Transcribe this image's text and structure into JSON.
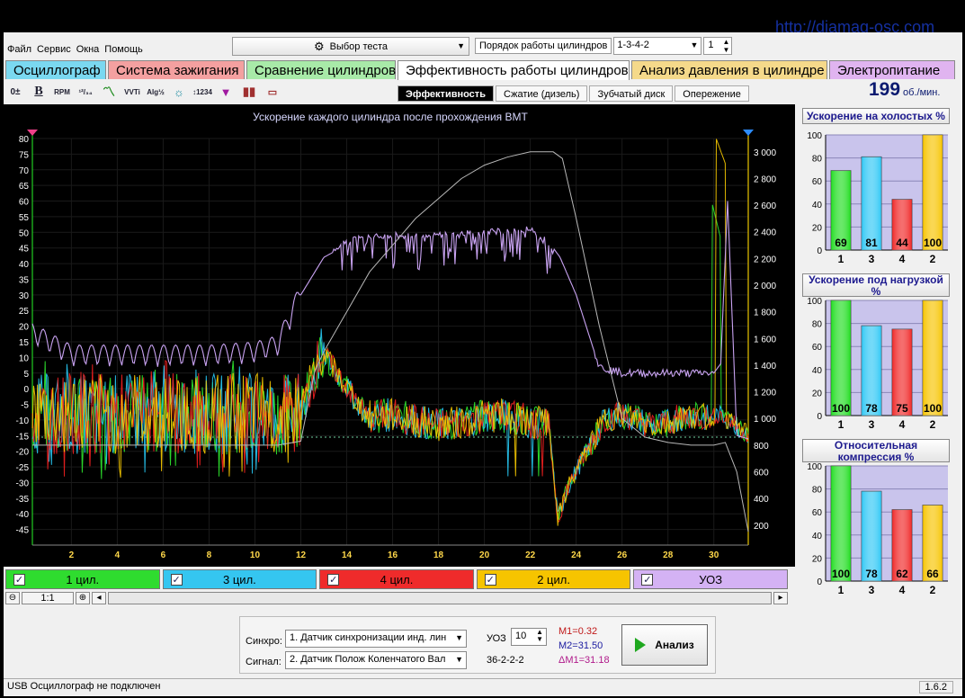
{
  "watermark": "http://diamag-osc.com",
  "menu": [
    "Файл",
    "Сервис",
    "Окна",
    "Помощь"
  ],
  "test_select": {
    "label": "Выбор теста"
  },
  "cylinder_order": {
    "label": "Порядок работы цилиндров",
    "value": "1-3-4-2",
    "spin_value": "1"
  },
  "tabs": [
    {
      "label": "Осциллограф",
      "color": "#7ad8f0"
    },
    {
      "label": "Система зажигания",
      "color": "#f4a0a0"
    },
    {
      "label": "Сравнение цилиндров",
      "color": "#a8eaa8"
    },
    {
      "label": "Эффективность работы цилиндров",
      "color": "#ffffff",
      "active": true
    },
    {
      "label": "Анализ давления в цилиндре",
      "color": "#f5d98a"
    },
    {
      "label": "Электропитание",
      "color": "#e0b4f0"
    }
  ],
  "toolbar_icons": [
    "zoom-spin-icon",
    "bold-icon",
    "rpm-icon",
    "ratio-icon",
    "line-icon",
    "vvti-icon",
    "alg-icon",
    "sensor-icon",
    "measure-icon",
    "filter-icon",
    "cylinders-icon",
    "print-icon"
  ],
  "subtabs": [
    "Эффективность",
    "Сжатие (дизель)",
    "Зубчатый диск",
    "Опережение"
  ],
  "rpm": {
    "value": "199",
    "unit": "об./мин."
  },
  "chart_data": {
    "type": "line",
    "title": "Ускорение каждого цилиндра после прохождения ВМТ",
    "x_ticks": [
      2,
      4,
      6,
      8,
      10,
      12,
      14,
      16,
      18,
      20,
      22,
      24,
      26,
      28,
      30
    ],
    "xlim": [
      0.3,
      31.5
    ],
    "left_ticks": [
      80,
      75,
      70,
      65,
      60,
      55,
      50,
      45,
      40,
      35,
      30,
      25,
      20,
      15,
      10,
      5,
      0,
      -5,
      -10,
      -15,
      -20,
      -25,
      -30,
      -35,
      -40,
      -45
    ],
    "left_ylim": [
      -50,
      80
    ],
    "right_ticks": [
      "3 000",
      "2 800",
      "2 600",
      "2 400",
      "2 200",
      "2 000",
      "1 800",
      "1 600",
      "1 400",
      "1 200",
      "1 000",
      "800",
      "600",
      "400",
      "200"
    ],
    "right_ylim": [
      50,
      3100
    ],
    "rpm_curve": {
      "x": [
        0.3,
        10,
        11,
        12,
        12.6,
        13,
        14,
        15,
        16,
        17,
        18,
        19,
        20,
        21,
        22,
        22.5,
        23,
        23.4,
        24,
        25,
        26,
        27,
        28,
        29,
        30,
        30.5,
        31,
        31.5
      ],
      "y": [
        800,
        800,
        800,
        830,
        1350,
        1500,
        1800,
        2100,
        2300,
        2500,
        2650,
        2800,
        2900,
        2960,
        3000,
        3000,
        3000,
        2950,
        2500,
        1700,
        1000,
        860,
        820,
        800,
        800,
        820,
        600,
        150
      ]
    },
    "uoz_curve": {
      "x": [
        0.3,
        2,
        5,
        8,
        10,
        11,
        12,
        13,
        14,
        15,
        16,
        18,
        20,
        22,
        23,
        23.3,
        24,
        25,
        26,
        27,
        28,
        29,
        30,
        30.3,
        30.6,
        31,
        31.5
      ],
      "y": [
        17,
        10,
        10,
        10,
        11,
        13,
        30,
        42,
        46,
        48,
        48,
        48,
        49,
        50,
        45,
        42,
        30,
        7,
        5,
        5,
        5,
        5,
        5,
        8,
        60,
        -15,
        -16
      ]
    },
    "series": [
      {
        "name": "1 цил.",
        "color": "#2ee62e"
      },
      {
        "name": "3 цил.",
        "color": "#27c7f2"
      },
      {
        "name": "4 цил.",
        "color": "#f02020"
      },
      {
        "name": "2 цил.",
        "color": "#f5c800"
      }
    ],
    "uoz_color": "#c9a3f2",
    "rpm_color": "#b8b8b8",
    "marker_left_color": "#f0408a",
    "marker_right_color": "#2d8cff"
  },
  "legend": [
    {
      "label": "1 цил.",
      "color": "#2fdc2f"
    },
    {
      "label": "3 цил.",
      "color": "#35c6f0"
    },
    {
      "label": "4 цил.",
      "color": "#ef2b2b"
    },
    {
      "label": "2 цил.",
      "color": "#f6c400"
    },
    {
      "label": "УОЗ",
      "color": "#d4b2f4"
    }
  ],
  "zoom": {
    "label": "1:1"
  },
  "bar_charts": [
    {
      "title": "Ускорение на холостых %",
      "categories": [
        "1",
        "3",
        "4",
        "2"
      ],
      "values": [
        69,
        81,
        44,
        100
      ],
      "ylim": [
        0,
        100
      ],
      "ticks": [
        100,
        80,
        60,
        40,
        20,
        0
      ]
    },
    {
      "title": "Ускорение под нагрузкой %",
      "categories": [
        "1",
        "3",
        "4",
        "2"
      ],
      "values": [
        100,
        78,
        75,
        100
      ],
      "ylim": [
        0,
        100
      ],
      "ticks": [
        100,
        80,
        60,
        40,
        20,
        0
      ]
    },
    {
      "title": "Относительная компрессия %",
      "categories": [
        "1",
        "3",
        "4",
        "2"
      ],
      "values": [
        100,
        78,
        62,
        66
      ],
      "ylim": [
        0,
        100
      ],
      "ticks": [
        100,
        80,
        60,
        40,
        20,
        0
      ]
    }
  ],
  "bar_colors": [
    "#22dd22",
    "#30c8f5",
    "#f02828",
    "#f7c400"
  ],
  "controls": {
    "sync_label": "Синхро:",
    "sync_value": "1. Датчик синхронизации инд. лин",
    "signal_label": "Сигнал:",
    "signal_value": "2. Датчик Полож Коленчатого Вал",
    "uoz_label": "УОЗ",
    "uoz_value": "10",
    "pattern": "36-2-2-2",
    "m1": "M1=0.32",
    "m2": "M2=31.50",
    "dm1": "ΔM1=31.18",
    "analyze": "Анализ"
  },
  "status": {
    "text": "USB Осциллограф не подключен",
    "version": "1.6.2"
  }
}
